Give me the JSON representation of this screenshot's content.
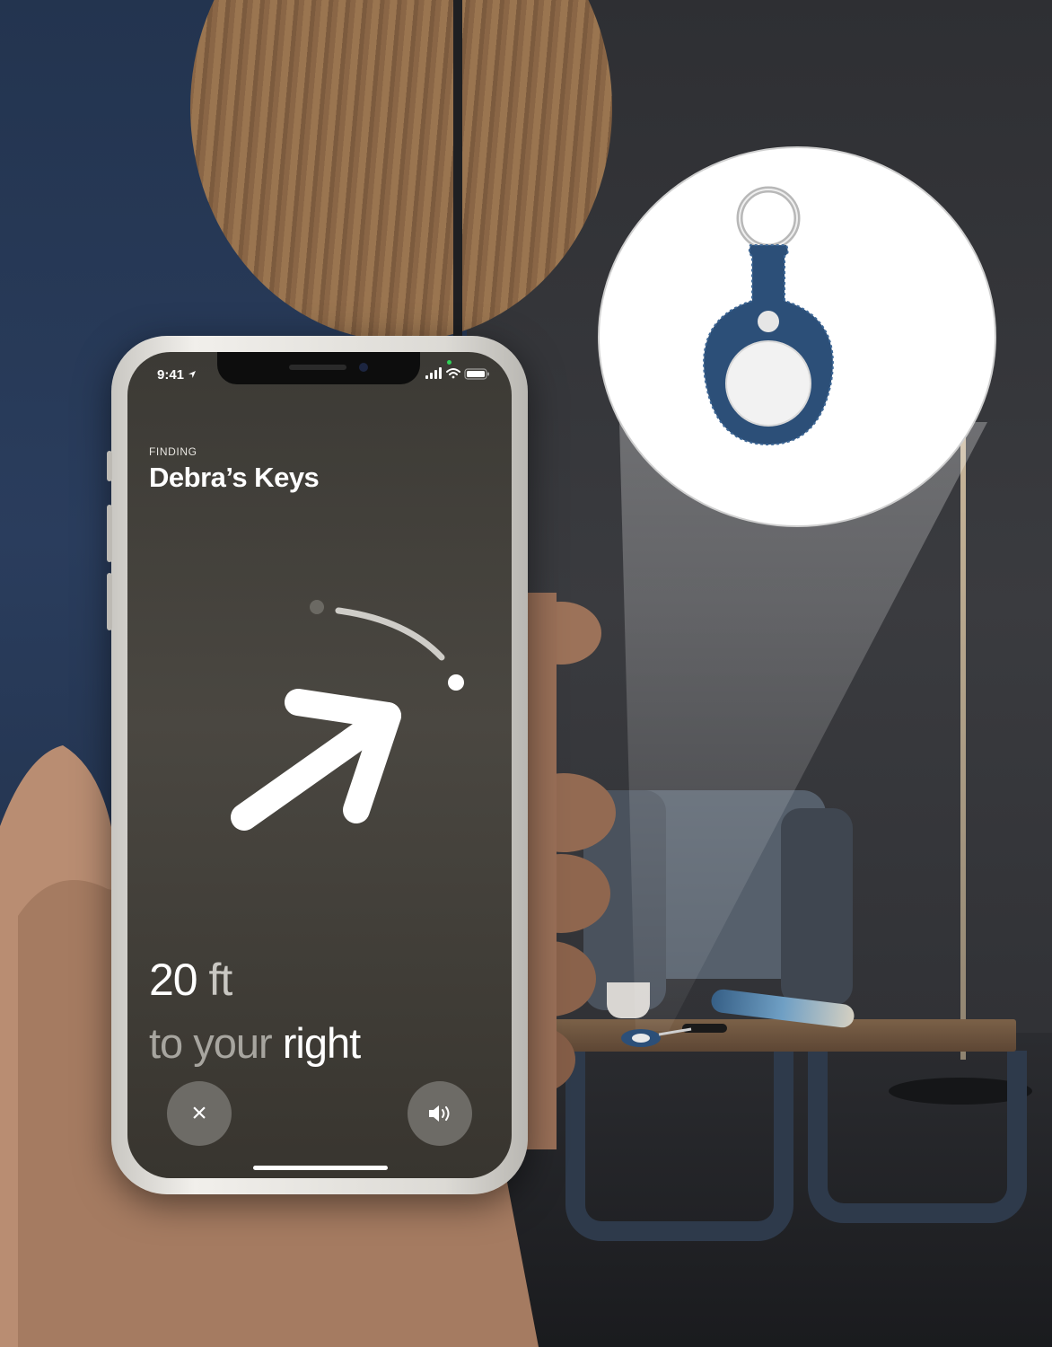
{
  "status_bar": {
    "time": "9:41"
  },
  "finding": {
    "label": "FINDING",
    "item_name": "Debra’s Keys",
    "distance_value": "20",
    "distance_unit": "ft",
    "direction_prefix": "to your",
    "direction_word": "right"
  },
  "controls": {
    "close_glyph": "×",
    "sound_icon": "speaker-icon"
  },
  "colors": {
    "screen_bg": "#3c3a35",
    "button_bg": "#6d6b66",
    "case_color": "#2c4f78",
    "tracker_white": "#f2f2f2"
  }
}
